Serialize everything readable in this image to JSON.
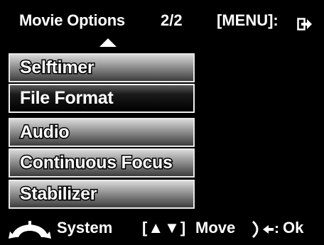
{
  "header": {
    "title": "Movie Options",
    "page_indicator": "2/2",
    "menu_hint": "[MENU]:",
    "exit_icon": "exit-arrow-icon",
    "scroll_up_icon": "triangle-up-icon"
  },
  "menu": {
    "items": [
      {
        "label": "Selftimer",
        "selected": false
      },
      {
        "label": "File Format",
        "selected": true
      },
      {
        "label": "Audio",
        "selected": false
      },
      {
        "label": "Continuous Focus",
        "selected": false
      },
      {
        "label": "Stabilizer",
        "selected": false
      }
    ]
  },
  "footer": {
    "system_icon": "system-dial-icon",
    "system_label": "System",
    "move_keys": "[▲▼]",
    "move_label": "Move",
    "ok_icon": "ok-arrow-icon",
    "ok_label": "Ok"
  },
  "colors": {
    "background": "#000000",
    "text": "#ffffff",
    "menu_border": "#e8e8e8"
  }
}
